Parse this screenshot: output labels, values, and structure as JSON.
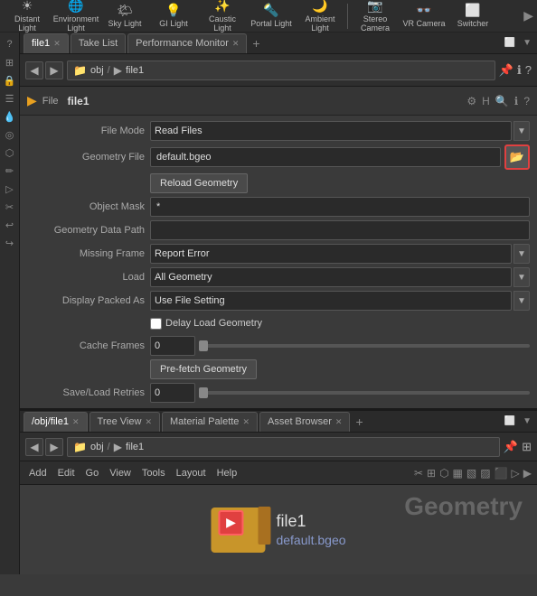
{
  "toolbar": {
    "items": [
      {
        "label": "Distant Light",
        "icon": "☀"
      },
      {
        "label": "Environment Light",
        "icon": "🌐"
      },
      {
        "label": "Sky Light",
        "icon": "🌤"
      },
      {
        "label": "GI Light",
        "icon": "💡"
      },
      {
        "label": "Caustic Light",
        "icon": "✨"
      },
      {
        "label": "Portal Light",
        "icon": "🔦"
      },
      {
        "label": "Ambient Light",
        "icon": "🌙"
      },
      {
        "label": "Stereo Camera",
        "icon": "📷"
      },
      {
        "label": "VR Camera",
        "icon": "👓"
      },
      {
        "label": "Switcher",
        "icon": "⬜"
      }
    ]
  },
  "tabs": {
    "upper": [
      {
        "label": "file1",
        "active": true,
        "closable": true
      },
      {
        "label": "Take List",
        "active": false,
        "closable": false
      },
      {
        "label": "Performance Monitor",
        "active": false,
        "closable": true
      }
    ],
    "lower": [
      {
        "label": "/obj/file1",
        "active": true,
        "closable": true
      },
      {
        "label": "Tree View",
        "active": false,
        "closable": true
      },
      {
        "label": "Material Palette",
        "active": false,
        "closable": true
      },
      {
        "label": "Asset Browser",
        "active": false,
        "closable": true
      }
    ]
  },
  "node": {
    "type": "File",
    "name": "file1",
    "display_name": "file1",
    "path_bgeo": "default.bgeo"
  },
  "properties": {
    "file_mode_label": "File Mode",
    "file_mode_value": "Read Files",
    "geometry_file_label": "Geometry File",
    "geometry_file_value": "default.bgeo",
    "reload_button": "Reload Geometry",
    "object_mask_label": "Object Mask",
    "object_mask_value": "*",
    "geometry_data_path_label": "Geometry Data Path",
    "geometry_data_path_value": "",
    "missing_frame_label": "Missing Frame",
    "missing_frame_value": "Report Error",
    "load_label": "Load",
    "load_value": "All Geometry",
    "display_packed_as_label": "Display Packed As",
    "display_packed_as_value": "Use File Setting",
    "delay_load_label": "Delay Load Geometry",
    "cache_frames_label": "Cache Frames",
    "cache_frames_value": "0",
    "prefetch_label": "Pre-fetch Geometry",
    "save_load_retries_label": "Save/Load Retries",
    "save_load_retries_value": "0"
  },
  "lower_toolbar": {
    "items": [
      "Add",
      "Edit",
      "Go",
      "View",
      "Tools",
      "Layout",
      "Help"
    ]
  },
  "geometry_view": {
    "label": "Geometry",
    "file_name": "file1",
    "file_path": "default.bgeo"
  },
  "path_bar": {
    "upper": {
      "icon": "📁",
      "path": "obj",
      "node": "file1"
    },
    "lower": {
      "icon": "📁",
      "path": "obj",
      "node": "file1"
    }
  }
}
